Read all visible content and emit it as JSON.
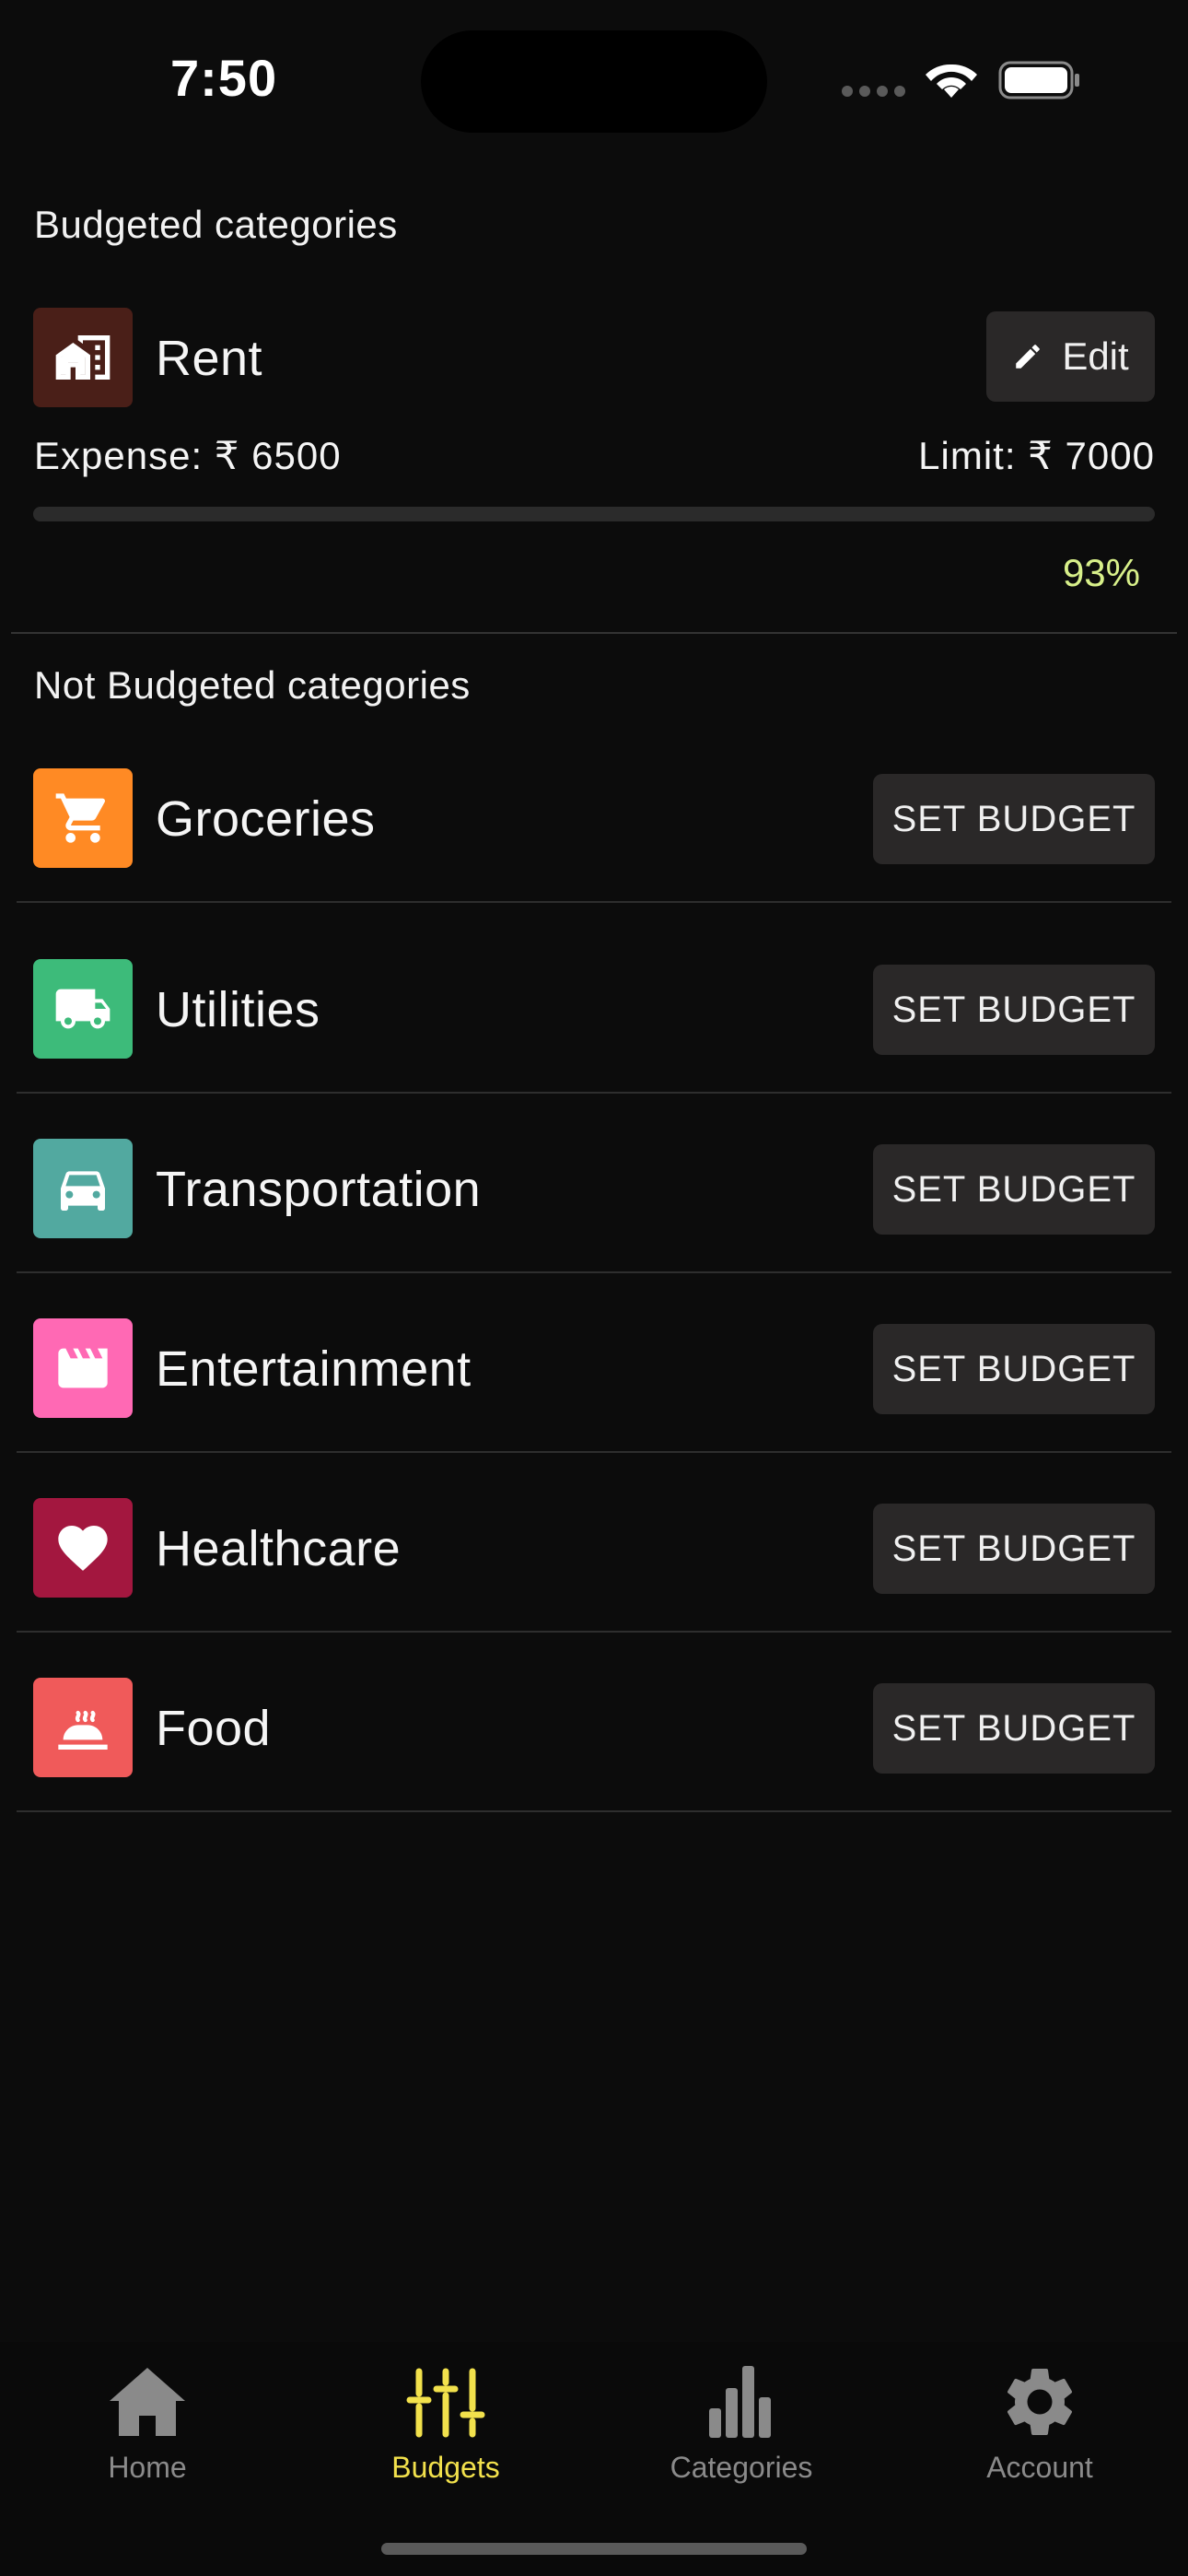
{
  "status": {
    "time": "7:50"
  },
  "budgeted": {
    "title": "Budgeted categories",
    "items": [
      {
        "name": "Rent",
        "icon": "building-icon",
        "color": "#4a1f18",
        "edit_label": "Edit",
        "expense_text": "Expense: ₹ 6500",
        "limit_text": "Limit: ₹  7000",
        "percent_text": "93%",
        "progress": 0.93
      }
    ]
  },
  "not_budgeted": {
    "title": "Not Budgeted categories",
    "button_label": "SET BUDGET",
    "items": [
      {
        "name": "Groceries",
        "icon": "cart-icon",
        "color": "#ff8a24"
      },
      {
        "name": "Utilities",
        "icon": "truck-icon",
        "color": "#3dbb7a"
      },
      {
        "name": "Transportation",
        "icon": "car-icon",
        "color": "#52a9a0"
      },
      {
        "name": "Entertainment",
        "icon": "clapperboard-icon",
        "color": "#ff69b4"
      },
      {
        "name": "Healthcare",
        "icon": "heart-icon",
        "color": "#a3173f"
      },
      {
        "name": "Food",
        "icon": "hot-dish-icon",
        "color": "#f05a5a"
      }
    ]
  },
  "nav": {
    "items": [
      {
        "label": "Home",
        "icon": "home-icon",
        "active": false
      },
      {
        "label": "Budgets",
        "icon": "sliders-icon",
        "active": true
      },
      {
        "label": "Categories",
        "icon": "bar-chart-icon",
        "active": false
      },
      {
        "label": "Account",
        "icon": "gear-icon",
        "active": false
      }
    ],
    "active_color": "#f2e14c",
    "inactive_color": "#8a8a8a"
  }
}
